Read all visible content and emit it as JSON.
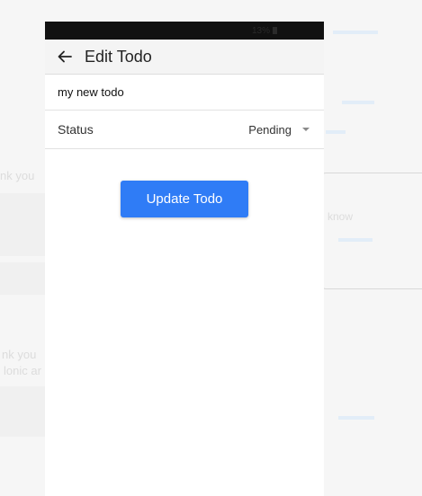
{
  "statusbar": {
    "battery_text": "13%"
  },
  "appbar": {
    "title": "Edit Todo",
    "back_icon": "arrow-left-icon"
  },
  "form": {
    "title_value": "my new todo",
    "status_label": "Status",
    "status_value": "Pending"
  },
  "actions": {
    "update_label": "Update Todo"
  },
  "background": {
    "text_a": "nk you",
    "text_b": "nk you",
    "text_c": "lonic ar",
    "text_d": "know"
  },
  "colors": {
    "accent": "#2f7cf6",
    "appbar_bg": "#f4f4f4",
    "statusbar_bg": "#111111"
  }
}
